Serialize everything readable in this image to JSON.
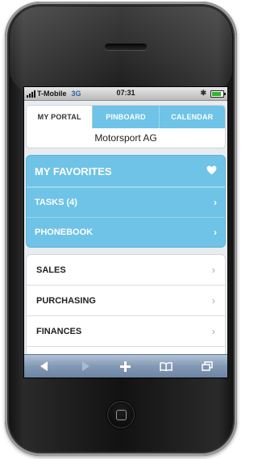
{
  "status_bar": {
    "carrier": "T-Mobile",
    "network": "3G",
    "time": "07:31",
    "bluetooth_icon": "bluetooth-icon",
    "battery_level": 0.85
  },
  "tabs": [
    {
      "label": "MY PORTAL",
      "active": true
    },
    {
      "label": "PINBOARD",
      "active": false
    },
    {
      "label": "CALENDAR",
      "active": false
    }
  ],
  "company": "Motorsport AG",
  "favorites": {
    "title": "MY FAVORITES",
    "icon": "heart-icon",
    "items": [
      {
        "label": "TASKS (4)"
      },
      {
        "label": "PHONEBOOK"
      }
    ]
  },
  "menu": {
    "items": [
      {
        "label": "SALES"
      },
      {
        "label": "PURCHASING"
      },
      {
        "label": "FINANCES"
      }
    ]
  },
  "toolbar": {
    "buttons": [
      "back-icon",
      "forward-icon",
      "add-icon",
      "bookmarks-icon",
      "pages-icon"
    ]
  },
  "colors": {
    "accent": "#6ec3e6",
    "status_green": "#2fb52c"
  }
}
